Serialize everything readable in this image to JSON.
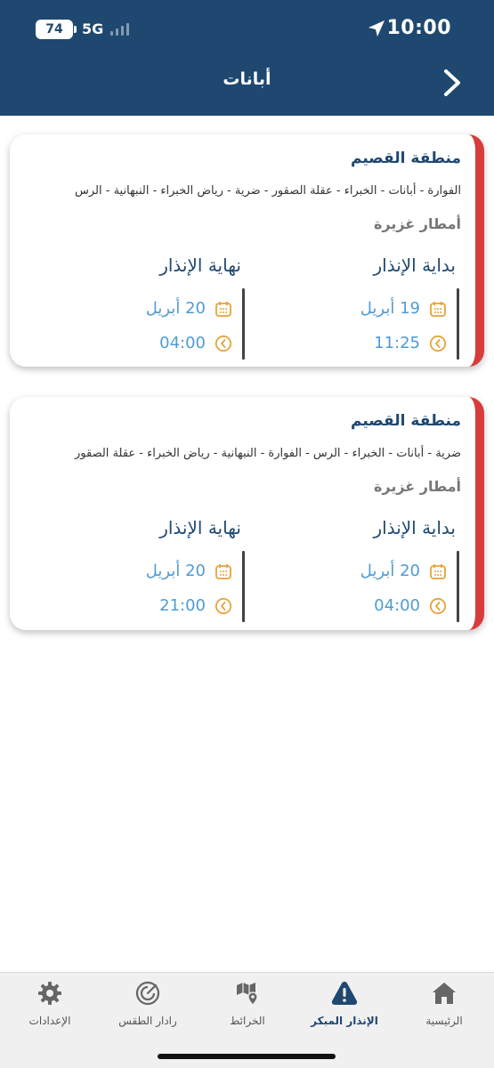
{
  "status_bar": {
    "time": "10:00",
    "battery": "74",
    "network": "5G"
  },
  "header": {
    "title": "أبانات"
  },
  "warnings": [
    {
      "region": "منطقة القصيم",
      "areas": "الفوارة - أبانات - الخبراء - عقلة الصقور - ضرية - رياض الخبراء - النبهانية - الرس",
      "type": "أمطار غزيرة",
      "start_label": "بداية الإنذار",
      "end_label": "نهاية الإنذار",
      "start_date": "19 أبريل",
      "start_time": "11:25",
      "end_date": "20 أبريل",
      "end_time": "04:00"
    },
    {
      "region": "منطقة القصيم",
      "areas": "ضرية - أبانات - الخبراء - الرس - الفوارة - النبهانية - رياض الخبراء - عقلة الصقور",
      "type": "أمطار غزيرة",
      "start_label": "بداية الإنذار",
      "end_label": "نهاية الإنذار",
      "start_date": "20 أبريل",
      "start_time": "04:00",
      "end_date": "20 أبريل",
      "end_time": "21:00"
    }
  ],
  "colors": {
    "header_bg": "#1f4870",
    "warning_strip": "#d73c3c",
    "value_text": "#4f9bd4",
    "icon_orange": "#e8a33a"
  },
  "tabbar": {
    "home": "الرئيسية",
    "early_warning": "الإنذار المبكر",
    "maps": "الخرائط",
    "weather_radar": "رادار الطقس",
    "settings": "الإعدادات"
  }
}
